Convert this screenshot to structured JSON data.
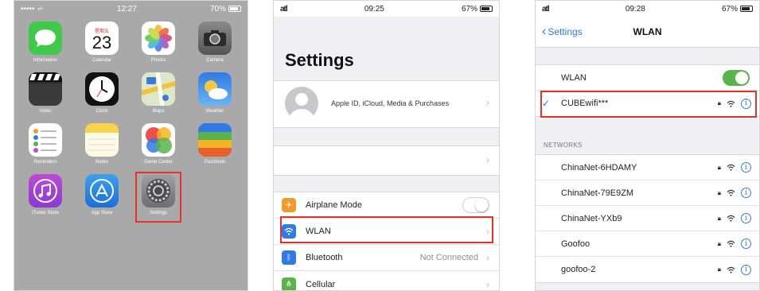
{
  "home": {
    "status": {
      "carrier": "••••• ⩫",
      "time": "12:27",
      "battery": "70%"
    },
    "apps": [
      {
        "label": "Information",
        "icon": "messages-icon",
        "color": "#3fc84a"
      },
      {
        "label": "Calendar",
        "icon": "calendar-icon",
        "color": "#ffffff",
        "day": "23",
        "month": "星期五"
      },
      {
        "label": "Photos",
        "icon": "photos-icon",
        "color": "#ffffff"
      },
      {
        "label": "Camera",
        "icon": "camera-icon",
        "color": "#6b6b6b"
      },
      {
        "label": "Video",
        "icon": "video-icon",
        "color": "#2c2c2c"
      },
      {
        "label": "Clock",
        "icon": "clock-icon",
        "color": "#111111"
      },
      {
        "label": "Maps",
        "icon": "maps-icon",
        "color": "#e9e4d4"
      },
      {
        "label": "Weather",
        "icon": "weather-icon",
        "color": "#3d8ee8"
      },
      {
        "label": "Reminders",
        "icon": "reminders-icon",
        "color": "#ffffff"
      },
      {
        "label": "Notes",
        "icon": "notes-icon",
        "color": "#f7d54a"
      },
      {
        "label": "Game Center",
        "icon": "game-center-icon",
        "color": "#ffffff"
      },
      {
        "label": "Passbook",
        "icon": "passbook-icon",
        "color": "#2c6fd6"
      },
      {
        "label": "iTunes Store",
        "icon": "itunes-store-icon",
        "color": "#c048d6"
      },
      {
        "label": "App Store",
        "icon": "app-store-icon",
        "color": "#2e88ea"
      },
      {
        "label": "Settings",
        "icon": "settings-icon",
        "color": "#8e8e93"
      }
    ]
  },
  "settings": {
    "status": {
      "signal": "atl",
      "time": "09:25",
      "battery": "67%"
    },
    "title": "Settings",
    "profile_text": "Apple ID, iCloud, Media & Purchases",
    "rows": [
      {
        "label": "Airplane Mode",
        "icon_color": "#f29a2e",
        "glyph": "✈"
      },
      {
        "label": "WLAN",
        "icon_color": "#2f7ae5",
        "glyph": "◠"
      },
      {
        "label": "Bluetooth",
        "icon_color": "#2f7ae5",
        "glyph": "ᛒ",
        "value": "Not Connected"
      },
      {
        "label": "Cellular",
        "icon_color": "#5ab44b",
        "glyph": "⋔"
      }
    ]
  },
  "wlan": {
    "status": {
      "signal": "atl",
      "time": "09:28",
      "battery": "67%"
    },
    "back_label": "Settings",
    "title": "WLAN",
    "wlan_label": "WLAN",
    "connected_network": "CUBEwifi***",
    "networks_header": "NETWORKS",
    "networks": [
      "ChinaNet-6HDAMY",
      "ChinaNet-79E9ZM",
      "ChinaNet-YXb9",
      "Goofoo",
      "goofoo-2"
    ]
  },
  "colors": {
    "highlight": "#e8312a",
    "ios_blue": "#2f7ae5",
    "toggle_on": "#5ab44b"
  }
}
